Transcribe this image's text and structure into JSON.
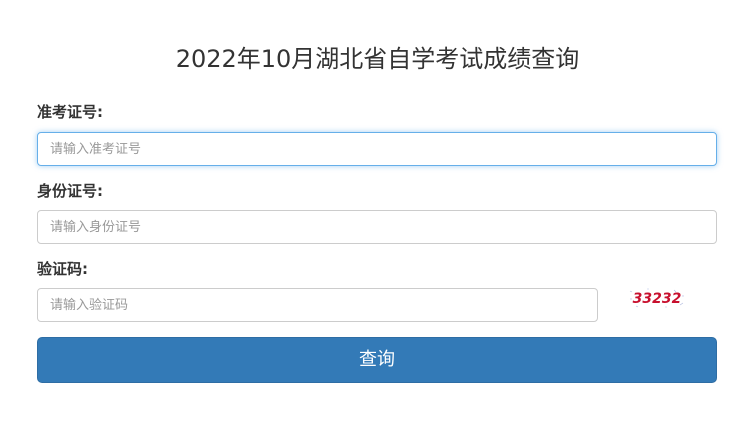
{
  "page": {
    "title": "2022年10月湖北省自学考试成绩查询"
  },
  "form": {
    "exam_id": {
      "label": "准考证号:",
      "placeholder": "请输入准考证号",
      "value": ""
    },
    "id_number": {
      "label": "身份证号:",
      "placeholder": "请输入身份证号",
      "value": ""
    },
    "captcha": {
      "label": "验证码:",
      "placeholder": "请输入验证码",
      "value": "",
      "image_text": "33232",
      "image_color": "#c8102e"
    },
    "submit_label": "查询"
  },
  "colors": {
    "primary": "#337ab7",
    "focus": "#66afe9",
    "border": "#cccccc"
  }
}
